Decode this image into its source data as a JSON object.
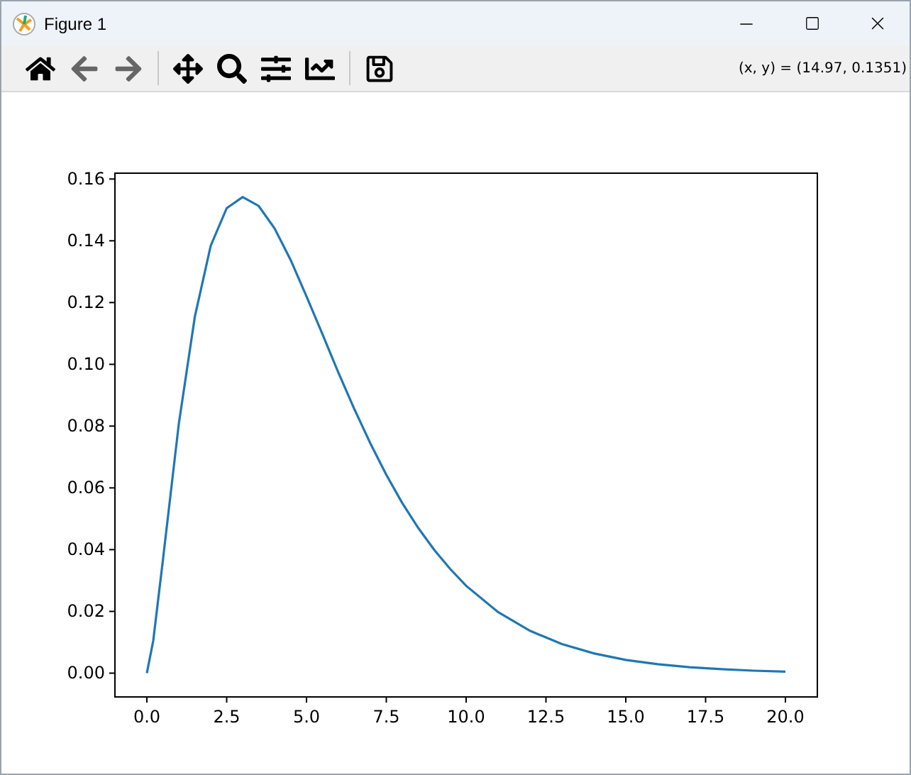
{
  "window": {
    "title": "Figure 1"
  },
  "toolbar": {
    "buttons": [
      {
        "kind": "home",
        "disabled": false
      },
      {
        "kind": "back",
        "disabled": true
      },
      {
        "kind": "forward",
        "disabled": true
      },
      {
        "kind": "pan",
        "disabled": false
      },
      {
        "kind": "zoom",
        "disabled": false
      },
      {
        "kind": "subplots",
        "disabled": false
      },
      {
        "kind": "customize",
        "disabled": false
      },
      {
        "kind": "save",
        "disabled": false
      }
    ],
    "coordinates": "(x, y) = (14.97, 0.1351)"
  },
  "figure": {
    "chart_data": {
      "type": "line",
      "x": [
        0,
        0.2,
        0.5,
        1,
        1.5,
        2,
        2.5,
        3,
        3.5,
        4,
        4.5,
        5,
        5.5,
        6,
        6.5,
        7,
        7.5,
        8,
        8.5,
        9,
        9.5,
        10,
        11,
        12,
        13,
        14,
        15,
        16,
        17,
        18,
        19,
        20
      ],
      "series": [
        {
          "color": "#1f77b4",
          "values": [
            0,
            0.0105,
            0.0366,
            0.0807,
            0.1154,
            0.1384,
            0.1506,
            0.1542,
            0.1513,
            0.144,
            0.1338,
            0.122,
            0.1097,
            0.0973,
            0.0854,
            0.0744,
            0.0642,
            0.0551,
            0.047,
            0.0399,
            0.0337,
            0.0283,
            0.0198,
            0.0137,
            0.0094,
            0.0064,
            0.0043,
            0.0029,
            0.0019,
            0.0013,
            0.0008,
            0.0005
          ]
        }
      ],
      "xlim": [
        -1,
        21
      ],
      "ylim": [
        -0.0077,
        0.1619
      ],
      "xticks": [
        {
          "value": 0,
          "label": "0.0"
        },
        {
          "value": 2.5,
          "label": "2.5"
        },
        {
          "value": 5,
          "label": "5.0"
        },
        {
          "value": 7.5,
          "label": "7.5"
        },
        {
          "value": 10,
          "label": "10.0"
        },
        {
          "value": 12.5,
          "label": "12.5"
        },
        {
          "value": 15,
          "label": "15.0"
        },
        {
          "value": 17.5,
          "label": "17.5"
        },
        {
          "value": 20,
          "label": "20.0"
        }
      ],
      "yticks": [
        {
          "value": 0,
          "label": "0.00"
        },
        {
          "value": 0.02,
          "label": "0.02"
        },
        {
          "value": 0.04,
          "label": "0.04"
        },
        {
          "value": 0.06,
          "label": "0.06"
        },
        {
          "value": 0.08,
          "label": "0.08"
        },
        {
          "value": 0.1,
          "label": "0.10"
        },
        {
          "value": 0.12,
          "label": "0.12"
        },
        {
          "value": 0.14,
          "label": "0.14"
        },
        {
          "value": 0.16,
          "label": "0.16"
        }
      ]
    }
  }
}
